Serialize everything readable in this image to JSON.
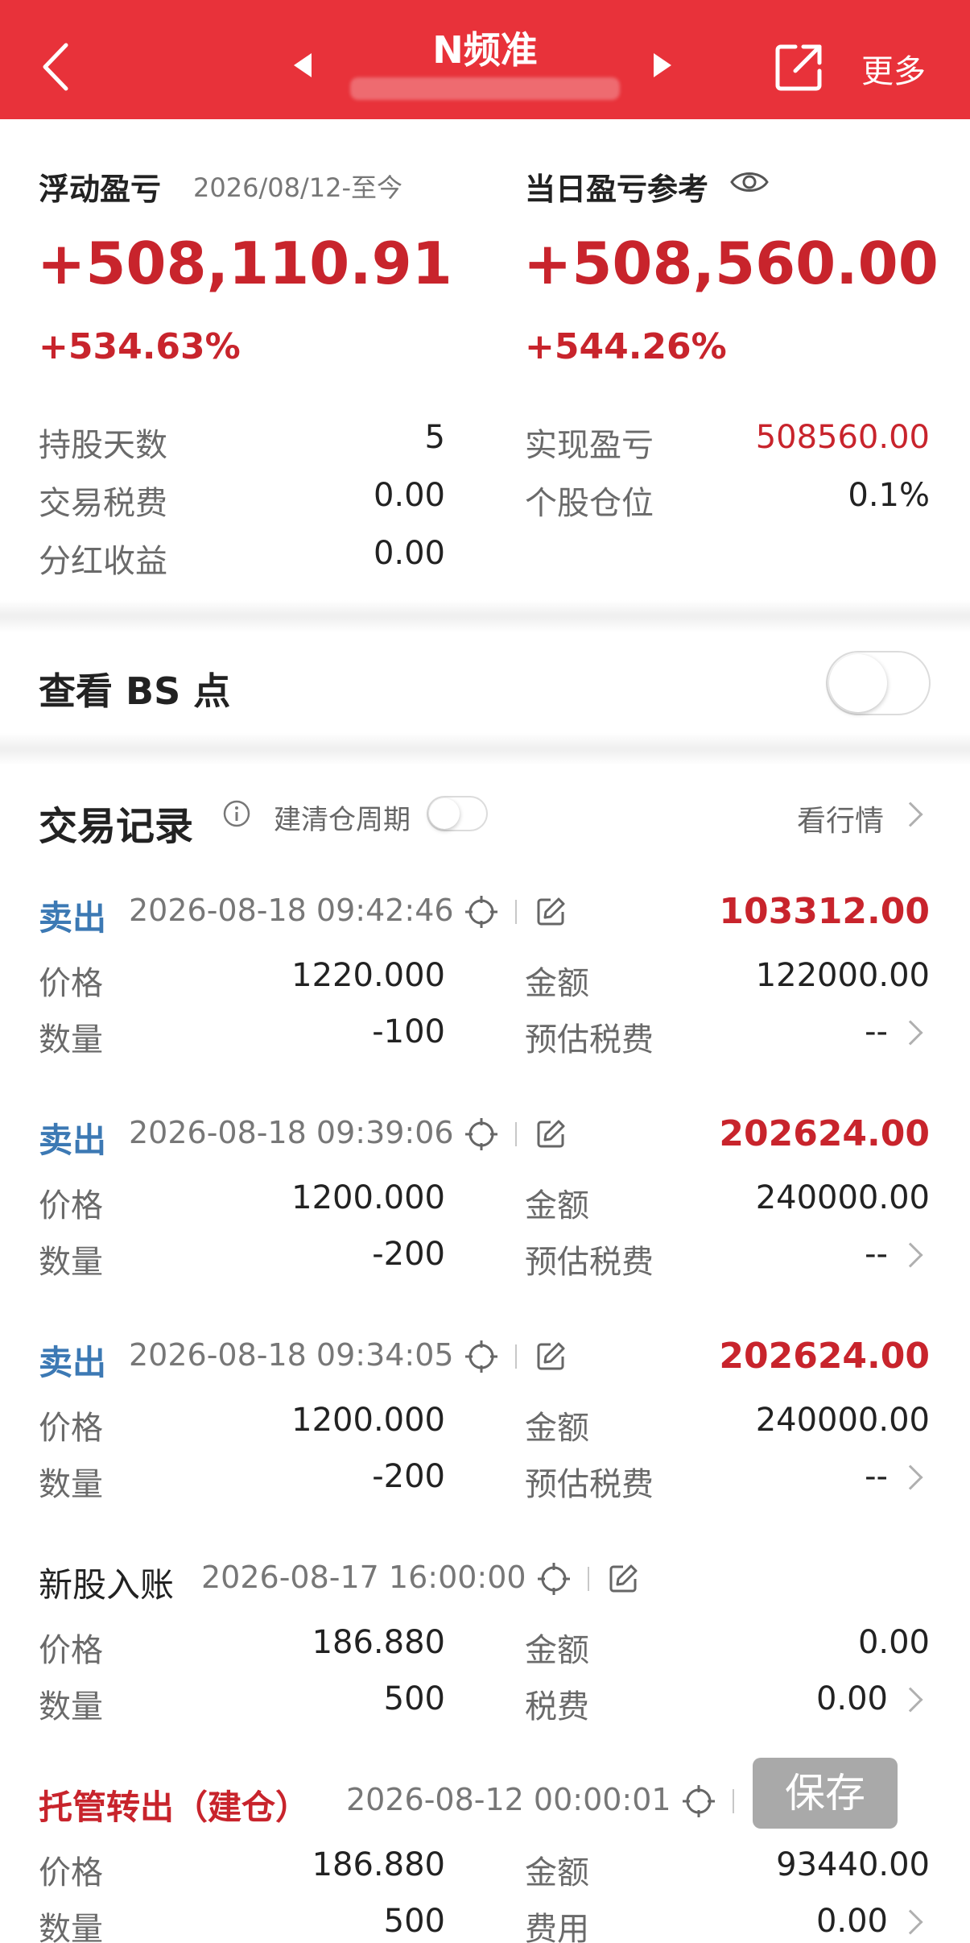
{
  "header": {
    "title": "N频准",
    "more_label": "更多",
    "subtitle_blurred": true,
    "accent_color": "#e8323a",
    "icons": [
      "back-arrow-icon",
      "prev-triangle-icon",
      "next-triangle-icon",
      "share-icon"
    ]
  },
  "summary": {
    "float_pnl_label": "浮动盈亏",
    "float_pnl_period": "2026/08/12-至今",
    "float_pnl_value": "+508,110.91",
    "float_pnl_pct": "+534.63%",
    "day_pnl_label": "当日盈亏参考",
    "day_pnl_value": "+508,560.00",
    "day_pnl_pct": "+544.26%",
    "stats_left": [
      {
        "label": "持股天数",
        "value": "5"
      },
      {
        "label": "交易税费",
        "value": "0.00"
      },
      {
        "label": "分红收益",
        "value": "0.00"
      }
    ],
    "stats_right": [
      {
        "label": "实现盈亏",
        "value": "508560.00"
      },
      {
        "label": "个股仓位",
        "value": "0.1%"
      }
    ]
  },
  "bs": {
    "label": "查看 BS 点",
    "toggle_on": false
  },
  "records": {
    "title": "交易记录",
    "cycle_label": "建清仓周期",
    "cycle_toggle_on": false,
    "market_link": "看行情",
    "items": [
      {
        "type": "卖出",
        "time": "2026-08-18 09:42:46",
        "amount": "103312.00",
        "price_label": "价格",
        "price": "1220.000",
        "total_label": "金额",
        "total": "122000.00",
        "qty_label": "数量",
        "qty": "-100",
        "fee_label": "预估税费",
        "fee": "--"
      },
      {
        "type": "卖出",
        "time": "2026-08-18 09:39:06",
        "amount": "202624.00",
        "price_label": "价格",
        "price": "1200.000",
        "total_label": "金额",
        "total": "240000.00",
        "qty_label": "数量",
        "qty": "-200",
        "fee_label": "预估税费",
        "fee": "--"
      },
      {
        "type": "卖出",
        "time": "2026-08-18 09:34:05",
        "amount": "202624.00",
        "price_label": "价格",
        "price": "1200.000",
        "total_label": "金额",
        "total": "240000.00",
        "qty_label": "数量",
        "qty": "-200",
        "fee_label": "预估税费",
        "fee": "--"
      },
      {
        "type": "新股入账",
        "time": "2026-08-17 16:00:00",
        "amount": "",
        "price_label": "价格",
        "price": "186.880",
        "total_label": "金额",
        "total": "0.00",
        "qty_label": "数量",
        "qty": "500",
        "fee_label": "税费",
        "fee": "0.00"
      },
      {
        "type": "托管转出（建仓）",
        "time": "2026-08-12 00:00:01",
        "amount": "",
        "price_label": "价格",
        "price": "186.880",
        "total_label": "金额",
        "total": "93440.00",
        "qty_label": "数量",
        "qty": "500",
        "fee_label": "费用",
        "fee": "0.00"
      }
    ]
  },
  "save_button": "保存"
}
